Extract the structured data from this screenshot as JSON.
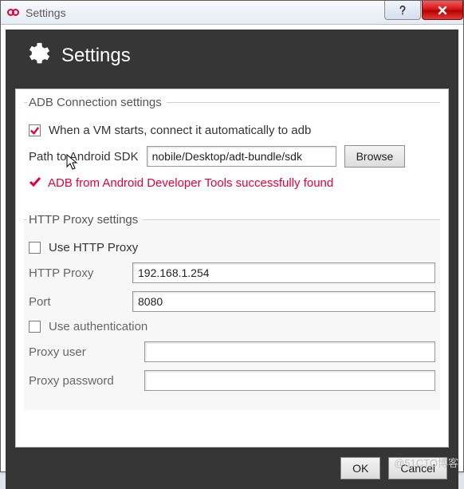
{
  "window": {
    "title": "Settings"
  },
  "banner": {
    "title": "Settings"
  },
  "adb": {
    "legend": "ADB Connection settings",
    "auto_connect_label": "When a VM starts, connect it automatically to adb",
    "auto_connect_checked": true,
    "sdk_path_label": "Path to Android SDK",
    "sdk_path_value": "nobile/Desktop/adt-bundle/sdk",
    "browse_label": "Browse",
    "status_text": "ADB from Android Developer Tools successfully found"
  },
  "http": {
    "legend": "HTTP Proxy settings",
    "use_proxy_label": "Use HTTP Proxy",
    "use_proxy_checked": false,
    "proxy_label": "HTTP Proxy",
    "proxy_value": "192.168.1.254",
    "port_label": "Port",
    "port_value": "8080",
    "use_auth_label": "Use authentication",
    "use_auth_checked": false,
    "user_label": "Proxy user",
    "user_value": "",
    "password_label": "Proxy password",
    "password_value": ""
  },
  "buttons": {
    "ok": "OK",
    "cancel": "Cancel"
  },
  "watermark": "@51CTO博客"
}
